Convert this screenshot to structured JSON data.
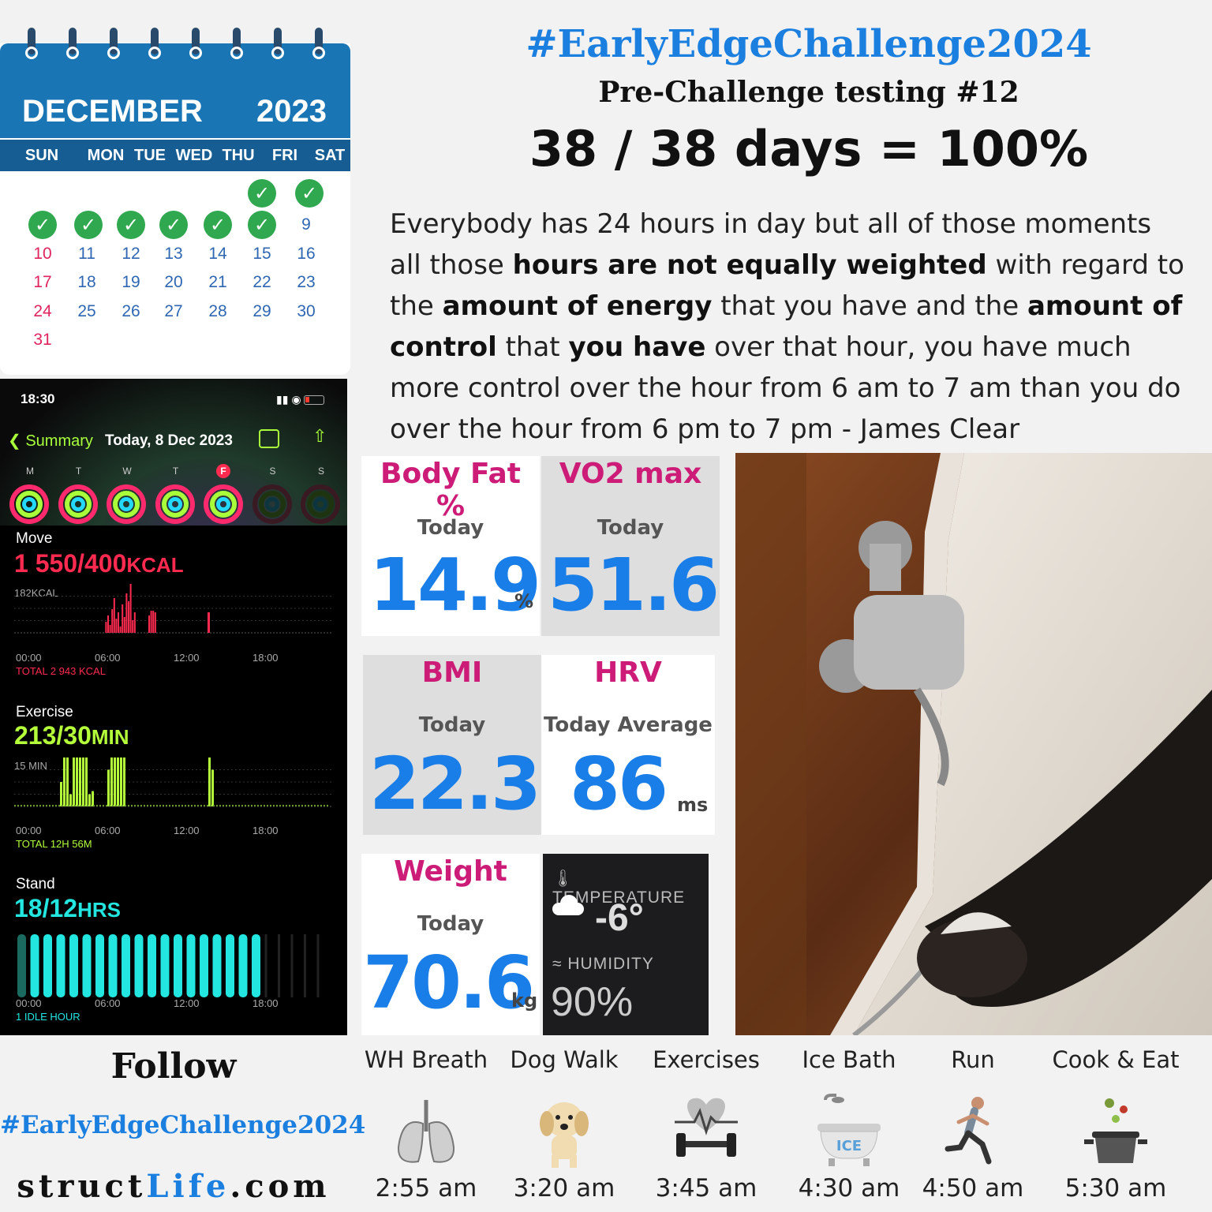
{
  "calendar": {
    "month": "DECEMBER",
    "year": "2023",
    "weekdays": [
      "SUN",
      "MON",
      "TUE",
      "WED",
      "THU",
      "FRI",
      "SAT"
    ],
    "check_color": "#2fa84f",
    "days": [
      "9",
      "10",
      "11",
      "12",
      "13",
      "14",
      "15",
      "16",
      "17",
      "18",
      "19",
      "20",
      "21",
      "22",
      "23",
      "24",
      "25",
      "26",
      "27",
      "28",
      "29",
      "30",
      "31"
    ]
  },
  "header": {
    "hashtag": "#EarlyEdgeChallenge2024",
    "subtitle": "Pre-Challenge testing #12",
    "score": "38 / 38 days = 100%"
  },
  "quote": {
    "p1": "Everybody has 24 hours in day but all of those moments all those ",
    "b1": "hours are not equally weighted",
    "p2": " with regard to the ",
    "b2": "amount of energy",
    "p3": " that you have and the ",
    "b3": "amount of control",
    "p4": " that ",
    "b4": "you have",
    "p5": " over that hour, you have much more control over the hour from 6 am to 7 am than you do over the hour from 6 pm to 7 pm - James Clear"
  },
  "phone": {
    "time": "18:30",
    "back_label": "Summary",
    "date": "Today, 8 Dec 2023",
    "week_letters": [
      "M",
      "T",
      "W",
      "T",
      "F",
      "S",
      "S"
    ],
    "move": {
      "label": "Move",
      "value": "1 550/400",
      "unit": "KCAL",
      "scale": "182KCAL",
      "total": "TOTAL 2 943 KCAL",
      "color": "#ff2a4f"
    },
    "exercise": {
      "label": "Exercise",
      "value": "213/30",
      "unit": "MIN",
      "scale": "15 MIN",
      "total": "TOTAL 12H 56M",
      "color": "#b4ff3a"
    },
    "stand": {
      "label": "Stand",
      "value": "18/12",
      "unit": "HRS",
      "total": "1 IDLE HOUR",
      "color": "#23e6e0"
    },
    "axis": [
      "00:00",
      "06:00",
      "12:00",
      "18:00"
    ]
  },
  "metrics": {
    "body_fat": {
      "name": "Body Fat %",
      "sub": "Today",
      "value": "14.9",
      "unit": "%"
    },
    "vo2": {
      "name": "VO2 max",
      "sub": "Today",
      "value": "51.6"
    },
    "bmi": {
      "name": "BMI",
      "sub": "Today",
      "value": "22.3"
    },
    "hrv": {
      "name": "HRV",
      "sub": "Today Average",
      "value": "86",
      "unit": "ms"
    },
    "weight": {
      "name": "Weight",
      "sub": "Today",
      "value": "70.6",
      "unit": "kg"
    }
  },
  "weather": {
    "temp_label": "TEMPERATURE",
    "temp": "-6°",
    "hum_label": "HUMIDITY",
    "humidity": "90%"
  },
  "footer": {
    "follow": "Follow",
    "hashtag": "#EarlyEdgeChallenge2024",
    "site_a": "struct",
    "site_b": "Life",
    "site_c": ".com"
  },
  "activities": [
    {
      "name": "WH Breath",
      "time": "2:55 am",
      "icon": "lungs-icon"
    },
    {
      "name": "Dog Walk",
      "time": "3:20 am",
      "icon": "puppy-icon"
    },
    {
      "name": "Exercises",
      "time": "3:45 am",
      "icon": "dumbbell-heart-icon"
    },
    {
      "name": "Ice Bath",
      "time": "4:30 am",
      "icon": "ice-bath-icon"
    },
    {
      "name": "Run",
      "time": "4:50 am",
      "icon": "runner-icon"
    },
    {
      "name": "Cook & Eat",
      "time": "5:30 am",
      "icon": "cooking-pot-icon"
    }
  ],
  "colors": {
    "blue": "#1b7fe0",
    "magenta": "#cc1c77",
    "cal_blue": "#1a75b4"
  }
}
